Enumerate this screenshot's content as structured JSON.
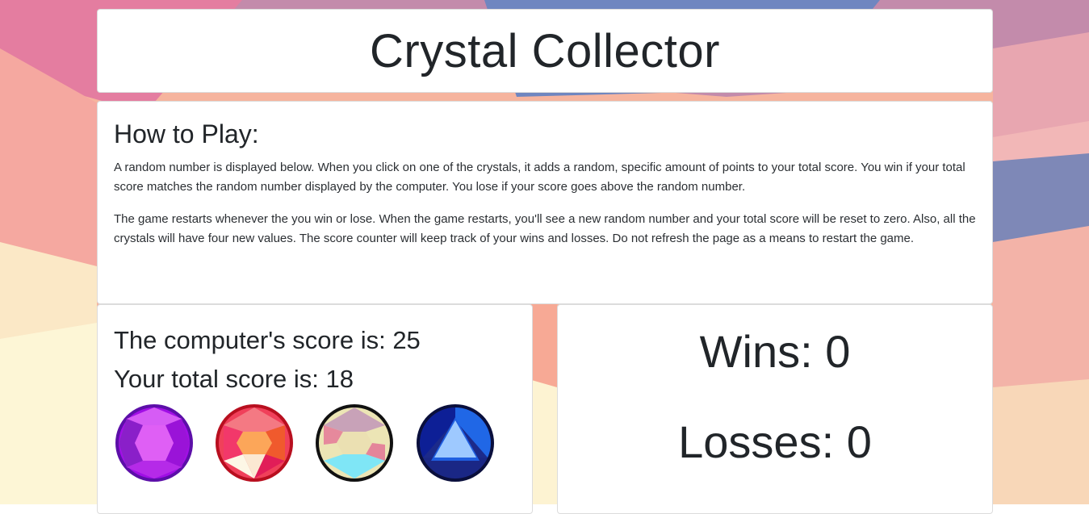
{
  "page": {
    "title": "Crystal Collector"
  },
  "instructions": {
    "heading": "How to Play:",
    "paragraph_1": "A random number is displayed below. When you click on one of the crystals, it adds a random, specific amount of points to your total score. You win if your total score matches the random number displayed by the computer. You lose if your score goes above the random number.",
    "paragraph_2": "The game restarts whenever the you win or lose. When the game restarts, you'll see a new random number and your total score will be reset to zero. Also, all the crystals will have four new values. The score counter will keep track of your wins and losses. Do not refresh the page as a means to restart the game."
  },
  "scores": {
    "computer_label": "The computer's score is: 25",
    "total_label": "Your total score is: 18"
  },
  "crystals": [
    {
      "icon": "amethyst-gem-icon",
      "color": "#a81bdc"
    },
    {
      "icon": "ruby-gem-icon",
      "color": "#e8323f"
    },
    {
      "icon": "pearl-gem-icon",
      "color": "#e9dfa8"
    },
    {
      "icon": "sapphire-gem-icon",
      "color": "#0a1a8c"
    }
  ],
  "record": {
    "wins_label": "Wins: 0",
    "losses_label": "Losses: 0"
  },
  "colors": {
    "card_background": "#ffffff",
    "text": "#212529"
  }
}
